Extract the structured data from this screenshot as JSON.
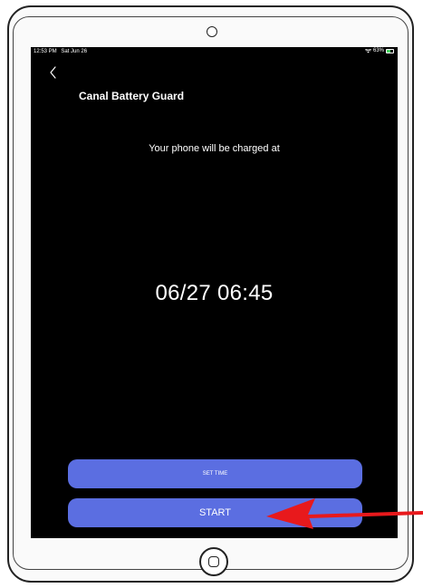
{
  "status_bar": {
    "time": "12:53 PM",
    "date": "Sat Jun 26",
    "battery_percent": "63%",
    "battery_level": 0.63,
    "battery_color": "#4cd964"
  },
  "header": {
    "back_icon": "chevron-left-icon",
    "title": "Canal Battery Guard"
  },
  "main": {
    "subtitle": "Your phone will be charged at",
    "charge_time": "06/27 06:45"
  },
  "buttons": {
    "set_time_label": "SET TIME",
    "start_label": "START",
    "color": "#5b6ee1"
  },
  "annotation": {
    "arrow_color": "#e8191c",
    "arrow_icon": "arrow-left-icon"
  }
}
